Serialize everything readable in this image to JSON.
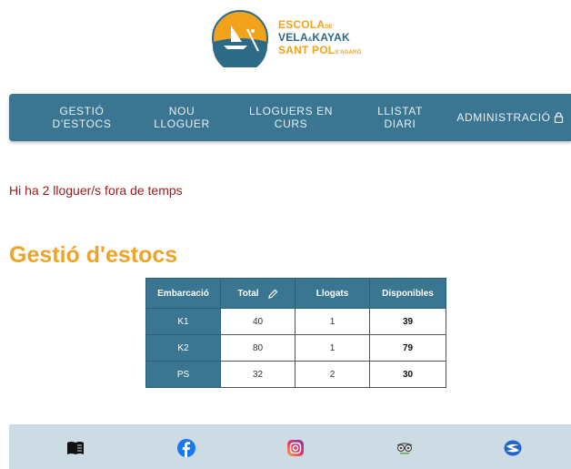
{
  "logo": {
    "line1": "ESCOLA",
    "line1_small": "DE",
    "line2": "VELA",
    "line2_small": "&",
    "line2b": "KAYAK",
    "line3": "SANT POL",
    "line3_small": "S'AGARÓ"
  },
  "nav": {
    "items": [
      {
        "label": "GESTIÓ\nD'ESTOCS"
      },
      {
        "label": "NOU\nLLOGUER"
      },
      {
        "label": "LLOGUERS EN\nCURS"
      },
      {
        "label": "LLISTAT\nDIARI"
      },
      {
        "label": "ADMINISTRACIÓ"
      }
    ]
  },
  "alert": {
    "text": "Hi ha 2 lloguer/s fora de temps"
  },
  "page_title": "Gestió d'estocs",
  "table": {
    "headers": [
      "Embarcació",
      "Total",
      "Llogats",
      "Disponibles"
    ],
    "rows": [
      [
        "K1",
        "40",
        "1",
        "39"
      ],
      [
        "K2",
        "80",
        "1",
        "79"
      ],
      [
        "PS",
        "32",
        "2",
        "30"
      ]
    ]
  },
  "footer": {
    "icons": [
      "book-icon",
      "facebook-icon",
      "instagram-icon",
      "tripadvisor-icon",
      "brand-s-icon"
    ]
  },
  "colors": {
    "nav_bg": "#3a7592",
    "accent": "#f0a327",
    "alert": "#a01c1c",
    "footer_bg": "#cddbe4"
  }
}
